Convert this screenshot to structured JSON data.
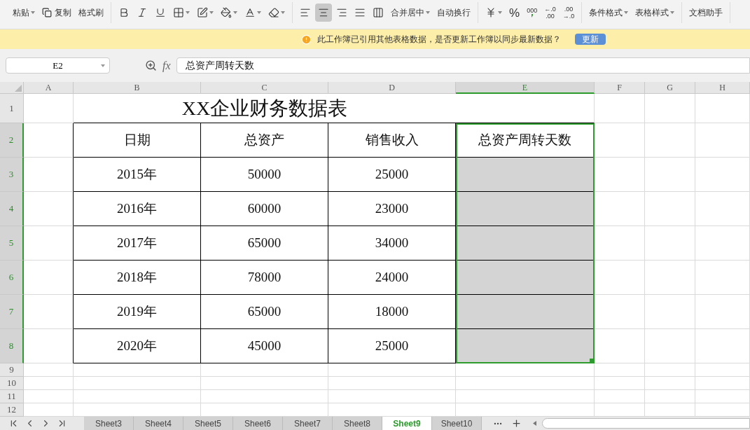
{
  "toolbar": {
    "groups": [
      {
        "items": [
          {
            "kind": "large",
            "label": "粘贴",
            "dropdown": true
          },
          {
            "kind": "copy",
            "label": "复制"
          },
          {
            "kind": "large",
            "label": "格式刷"
          }
        ]
      },
      {
        "items": [
          {
            "kind": "bold"
          },
          {
            "kind": "italic"
          },
          {
            "kind": "underline"
          },
          {
            "kind": "borders",
            "dropdown": true
          },
          {
            "kind": "cell-style",
            "dropdown": true
          },
          {
            "kind": "fill",
            "dropdown": true
          },
          {
            "kind": "font-color",
            "dropdown": true
          },
          {
            "kind": "eraser",
            "dropdown": true
          }
        ]
      },
      {
        "items": [
          {
            "kind": "align-left",
            "selected": false
          },
          {
            "kind": "align-center",
            "selected": true
          },
          {
            "kind": "align-right",
            "selected": false
          },
          {
            "kind": "align-justify",
            "selected": false
          },
          {
            "kind": "distribute",
            "selected": false
          },
          {
            "kind": "large",
            "label": "合并居中",
            "dropdown": true
          },
          {
            "kind": "large",
            "label": "自动换行"
          }
        ]
      },
      {
        "items": [
          {
            "kind": "currency",
            "dropdown": true
          },
          {
            "kind": "text",
            "label": "%"
          },
          {
            "kind": "thousands",
            "label": "000"
          },
          {
            "kind": "decimal",
            "lines": [
              "←.0",
              ".00"
            ]
          },
          {
            "kind": "decimal",
            "lines": [
              ".00",
              "→.0"
            ]
          }
        ]
      },
      {
        "items": [
          {
            "kind": "large",
            "label": "条件格式",
            "dropdown": true
          },
          {
            "kind": "large",
            "label": "表格样式",
            "dropdown": true
          }
        ]
      },
      {
        "items": [
          {
            "kind": "large",
            "label": "文档助手"
          }
        ]
      }
    ]
  },
  "notice": {
    "text": "此工作簿已引用其他表格数据，是否更新工作簿以同步最新数据？",
    "button": "更新"
  },
  "formula_bar": {
    "name_box": "E2",
    "fx": "fx",
    "value": "总资产周转天数"
  },
  "sheet": {
    "columns": [
      {
        "label": "A",
        "selected": false
      },
      {
        "label": "B",
        "selected": false
      },
      {
        "label": "C",
        "selected": false
      },
      {
        "label": "D",
        "selected": false
      },
      {
        "label": "E",
        "selected": true
      },
      {
        "label": "F",
        "selected": false
      },
      {
        "label": "G",
        "selected": false
      },
      {
        "label": "H",
        "selected": false
      }
    ],
    "rows": [
      {
        "label": "1",
        "selected": false
      },
      {
        "label": "2",
        "selected": true
      },
      {
        "label": "3",
        "selected": true
      },
      {
        "label": "4",
        "selected": true
      },
      {
        "label": "5",
        "selected": true
      },
      {
        "label": "6",
        "selected": true
      },
      {
        "label": "7",
        "selected": true
      },
      {
        "label": "8",
        "selected": true
      },
      {
        "label": "9",
        "selected": false
      },
      {
        "label": "10",
        "selected": false
      },
      {
        "label": "11",
        "selected": false
      },
      {
        "label": "12",
        "selected": false
      }
    ],
    "title": "XX企业财务数据表",
    "table": {
      "columns": [
        {
          "label": "日期",
          "selected": false
        },
        {
          "label": "总资产",
          "selected": false
        },
        {
          "label": "销售收入",
          "selected": false
        },
        {
          "label": "总资产周转天数",
          "selected": true
        }
      ],
      "rows": [
        [
          "2015年",
          "50000",
          "25000"
        ],
        [
          "2016年",
          "60000",
          "23000"
        ],
        [
          "2017年",
          "65000",
          "34000"
        ],
        [
          "2018年",
          "78000",
          "24000"
        ],
        [
          "2019年",
          "65000",
          "18000"
        ],
        [
          "2020年",
          "45000",
          "25000"
        ]
      ]
    }
  },
  "sheet_tabs": [
    {
      "label": "Sheet3",
      "selected": false
    },
    {
      "label": "Sheet4",
      "selected": false
    },
    {
      "label": "Sheet5",
      "selected": false
    },
    {
      "label": "Sheet6",
      "selected": false
    },
    {
      "label": "Sheet7",
      "selected": false
    },
    {
      "label": "Sheet8",
      "selected": false
    },
    {
      "label": "Sheet9",
      "selected": true
    },
    {
      "label": "Sheet10",
      "selected": false
    }
  ]
}
